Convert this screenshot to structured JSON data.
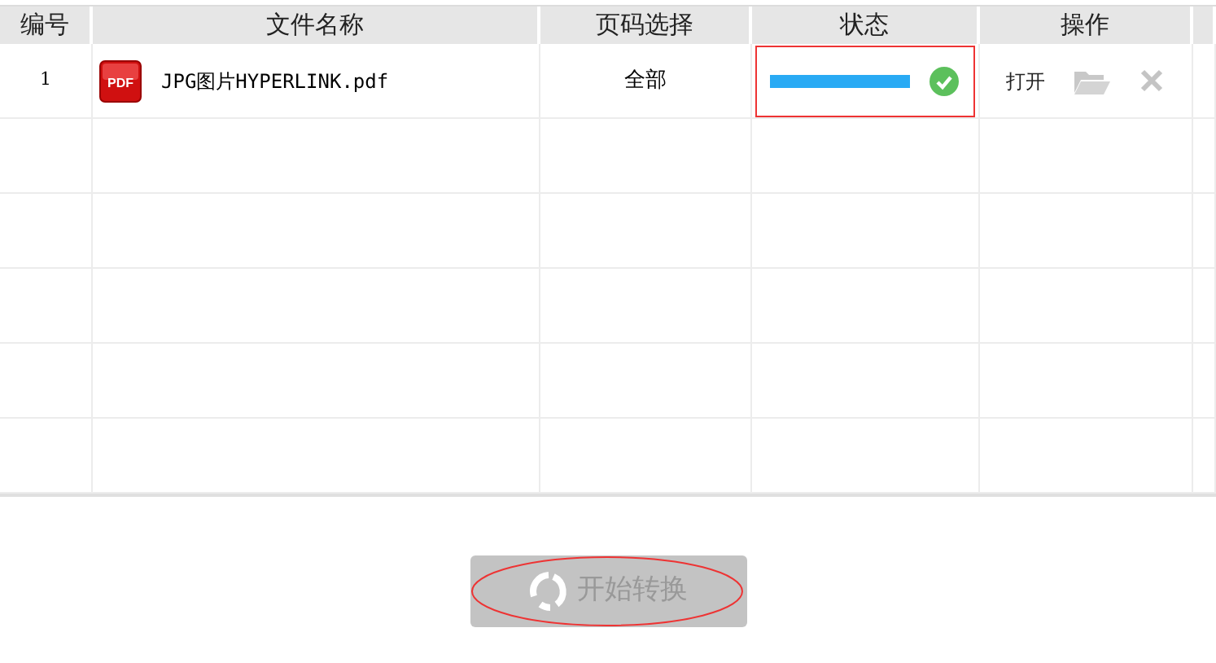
{
  "table": {
    "columns": [
      "编号",
      "文件名称",
      "页码选择",
      "状态",
      "操作"
    ],
    "rows": [
      {
        "number": "1",
        "file_icon_text": "PDF",
        "file_name": "JPG图片HYPERLINK.pdf",
        "pages": "全部",
        "progress": {
          "level": 1.0,
          "done": true,
          "highlighted": true
        },
        "open_label": "打开"
      }
    ]
  },
  "convert_button": {
    "label": "开始转换",
    "disabled": true,
    "circled": true
  }
}
